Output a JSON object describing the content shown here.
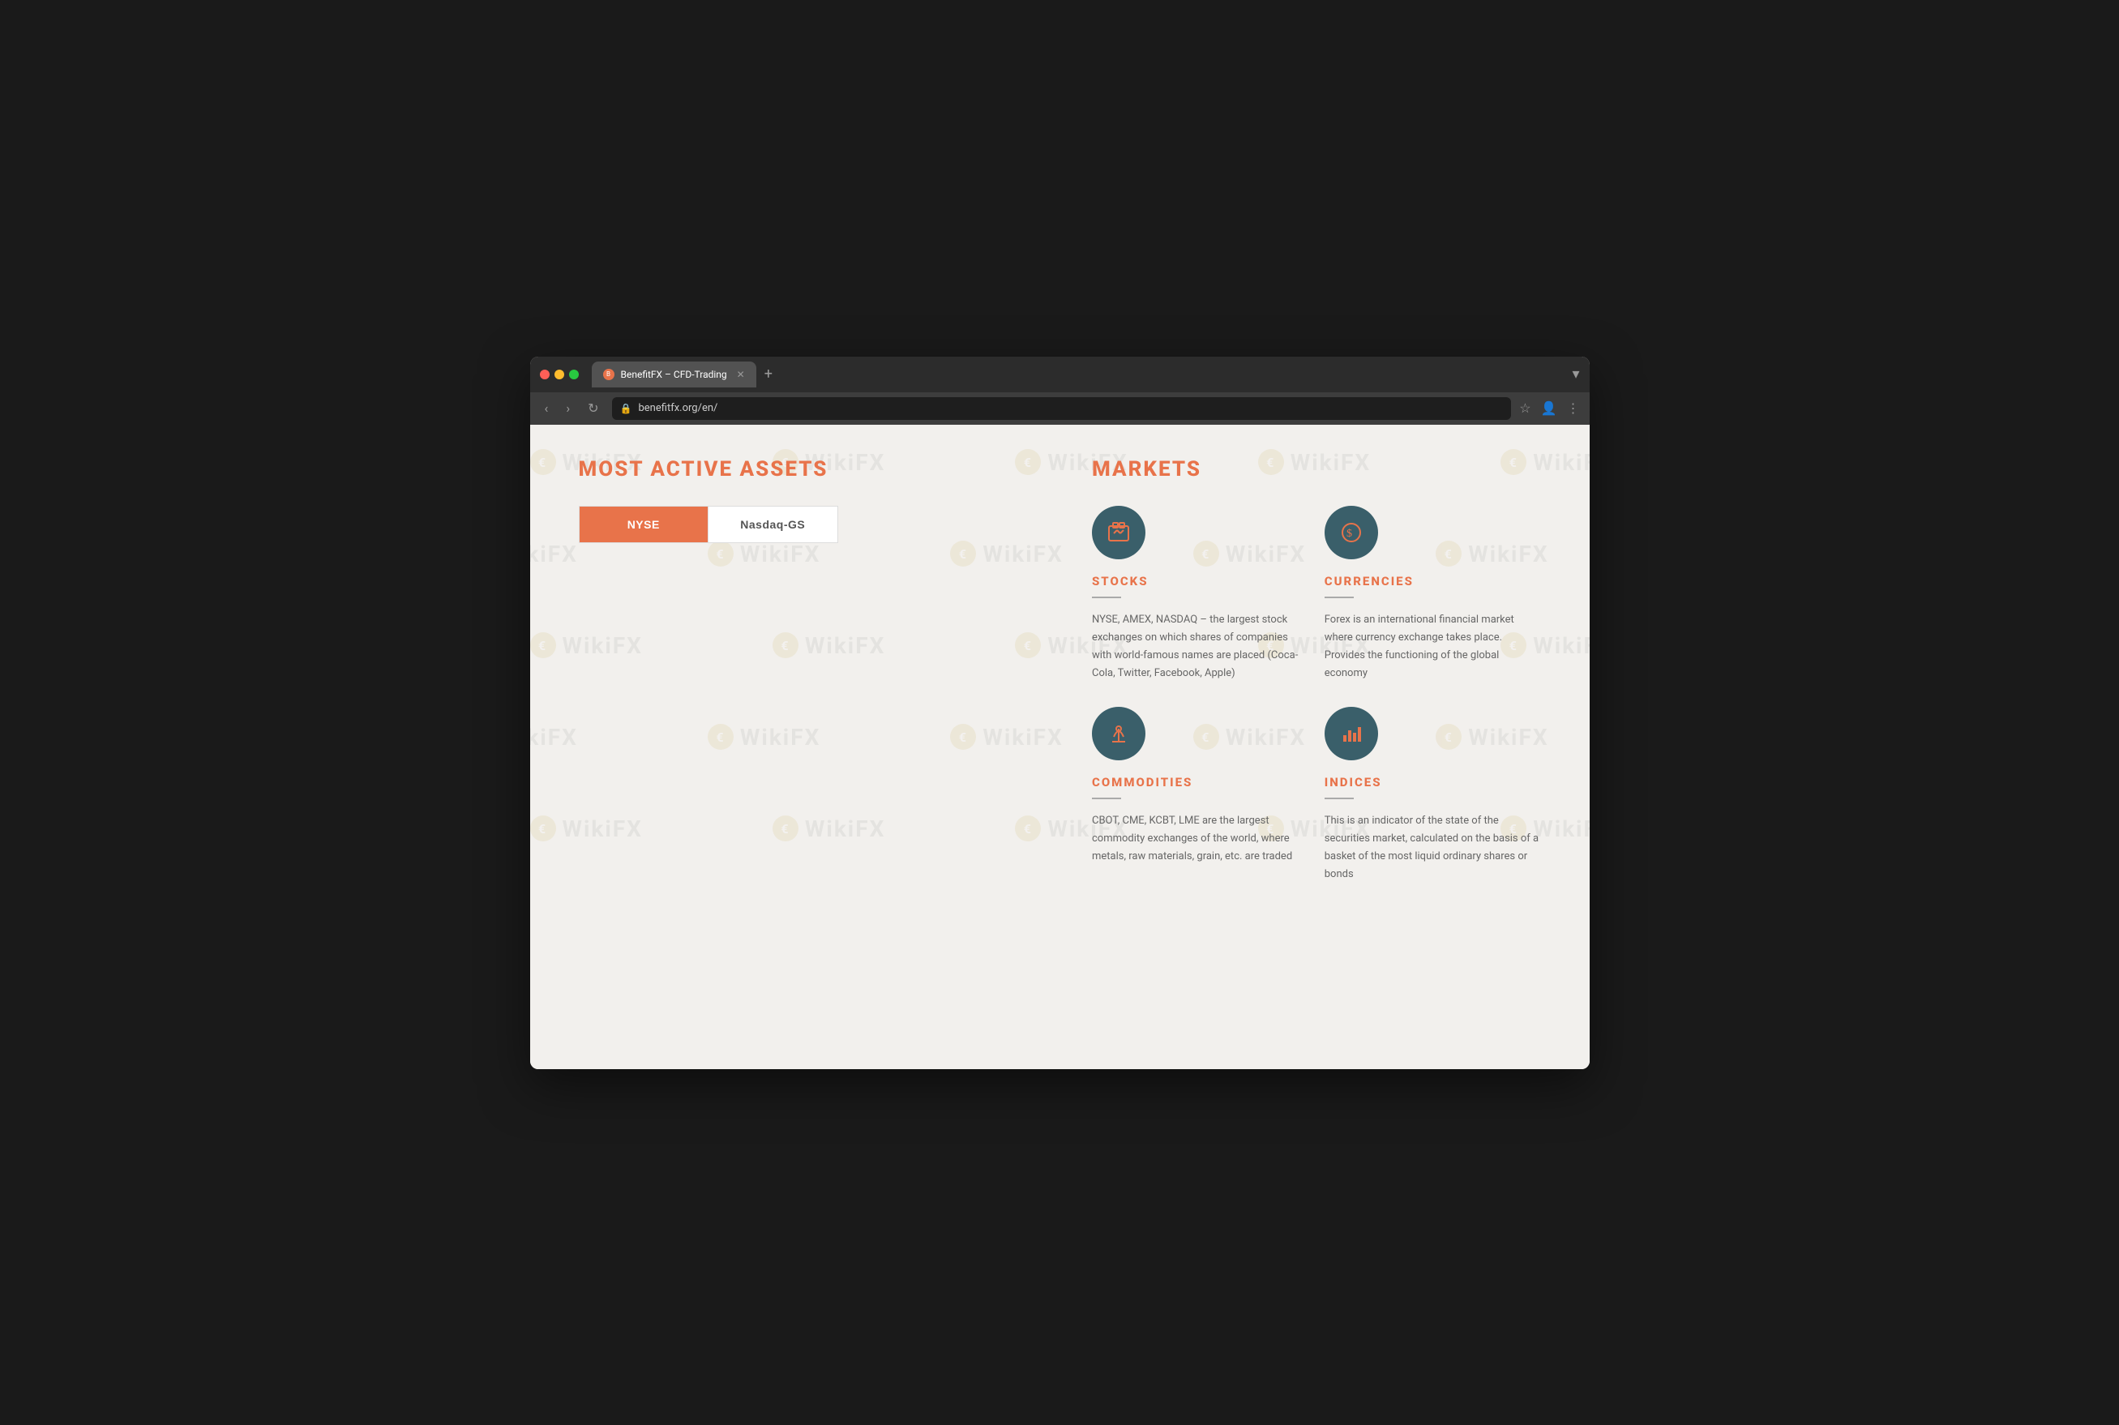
{
  "browser": {
    "tab_title": "BenefitFX – CFD-Trading",
    "url": "benefitfx.org/en/",
    "new_tab_label": "+",
    "dropdown_icon": "▾"
  },
  "left": {
    "title": "MOST ACTIVE ASSETS",
    "tabs": [
      {
        "label": "NYSE",
        "active": true
      },
      {
        "label": "Nasdaq-GS",
        "active": false
      }
    ]
  },
  "right": {
    "title": "MARKETS",
    "markets": [
      {
        "id": "stocks",
        "name": "STOCKS",
        "icon": "🏪",
        "description": "NYSE, AMEX, NASDAQ – the largest stock exchanges on which shares of companies with world-famous names are placed (Coca-Cola, Twitter, Facebook, Apple)"
      },
      {
        "id": "currencies",
        "name": "CURRENCIES",
        "icon": "💵",
        "description": "Forex is an international financial market where currency exchange takes place. Provides the functioning of the global economy"
      },
      {
        "id": "commodities",
        "name": "COMMODITIES",
        "icon": "⛽",
        "description": "CBOT, CME, KCBT, LME are the largest commodity exchanges of the world, where metals, raw materials, grain, etc. are traded"
      },
      {
        "id": "indices",
        "name": "INDICES",
        "icon": "📊",
        "description": "This is an indicator of the state of the securities market, calculated on the basis of a basket of the most liquid ordinary shares or bonds"
      }
    ]
  },
  "watermark": {
    "text": "WikiFX",
    "logo_letter": "€"
  },
  "colors": {
    "accent": "#e8734a",
    "teal": "#3a5f6a",
    "text_muted": "#666"
  }
}
